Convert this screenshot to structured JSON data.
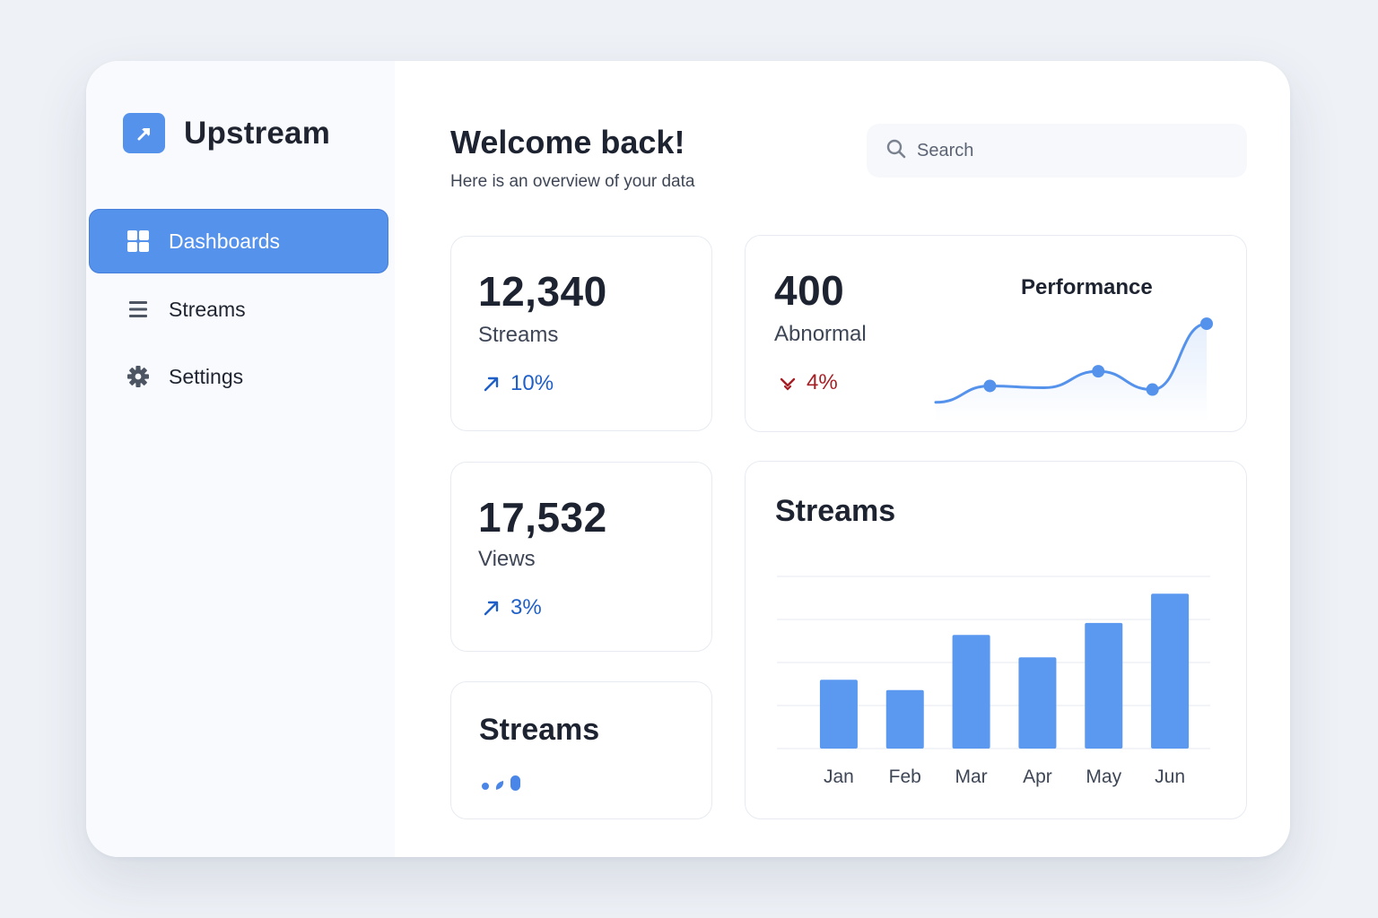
{
  "app": {
    "name": "Upstream",
    "logo_icon": "arrow-up-right-icon"
  },
  "sidebar": {
    "items": [
      {
        "label": "Dashboards",
        "icon": "grid-icon",
        "active": true
      },
      {
        "label": "Streams",
        "icon": "list-icon",
        "active": false
      },
      {
        "label": "Settings",
        "icon": "gear-icon",
        "active": false
      }
    ]
  },
  "header": {
    "title": "Welcome back!",
    "subtitle": "Here is an overview of your data",
    "search_placeholder": "Search"
  },
  "stats": {
    "streams": {
      "value": "12,340",
      "label": "Streams",
      "change": "10%",
      "direction": "up"
    },
    "abnormal": {
      "value": "400",
      "label": "Abnormal",
      "change": "4%",
      "direction": "down"
    },
    "views": {
      "value": "17,532",
      "label": "Views",
      "change": "3%",
      "direction": "up"
    }
  },
  "cards": {
    "performance_title": "Performance",
    "streams_small_title": "Streams",
    "streams_chart_title": "Streams"
  },
  "colors": {
    "accent": "#5592ec",
    "bar": "#5b98f0",
    "up": "#1f5fc8",
    "down": "#a51f24",
    "text": "#1d2330"
  },
  "chart_data": [
    {
      "type": "line",
      "title": "Performance",
      "x": [
        0,
        1,
        2,
        3,
        4,
        5
      ],
      "y": [
        5,
        14,
        13,
        22,
        12,
        48
      ],
      "markers": [
        1,
        3,
        4,
        5
      ],
      "ylim": [
        0,
        50
      ],
      "grid": false
    },
    {
      "type": "bar",
      "title": "Streams",
      "categories": [
        "Jan",
        "Feb",
        "Mar",
        "Apr",
        "May",
        "Jun"
      ],
      "values": [
        40,
        34,
        66,
        53,
        73,
        90
      ],
      "ylim": [
        0,
        100
      ],
      "grid": true
    }
  ]
}
